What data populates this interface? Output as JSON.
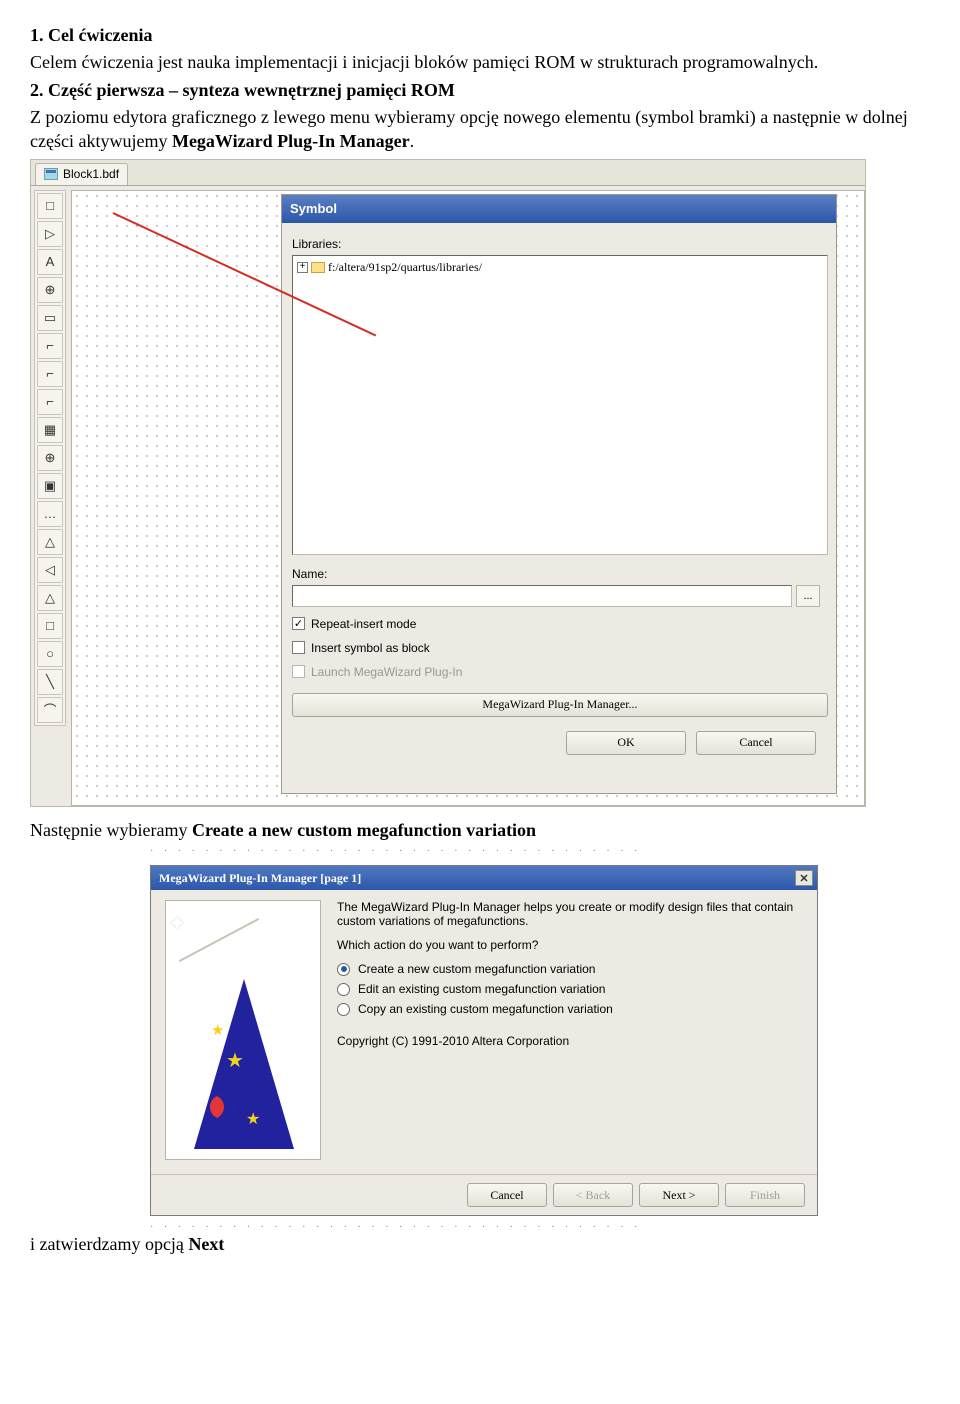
{
  "doc": {
    "h1": "1. Cel ćwiczenia",
    "p1": "Celem ćwiczenia jest nauka implementacji i inicjacji bloków pamięci ROM w strukturach programowalnych.",
    "h2": "2. Część pierwsza – synteza wewnętrznej pamięci ROM",
    "p2a": "Z poziomu edytora graficznego z lewego menu wybieramy opcję nowego elementu (symbol bramki) a następnie w dolnej części aktywujemy ",
    "p2b": "MegaWizard Plug-In Manager",
    "p2c": ".",
    "p3a": "Następnie wybieramy ",
    "p3b": "Create a new custom megafunction variation",
    "p4a": "i zatwierdzamy opcją ",
    "p4b": "Next"
  },
  "shot1": {
    "tab_label": "Block1.bdf",
    "tool_icons": [
      "□",
      "▷",
      "A",
      "⊕",
      "▭",
      "⌐",
      "⌐",
      "⌐",
      "▦",
      "⊕",
      "▣",
      "…",
      "△",
      "◁",
      "△",
      "□",
      "○",
      "╲",
      "⌒"
    ],
    "dialog_title": "Symbol",
    "libraries_label": "Libraries:",
    "tree_item": "f:/altera/91sp2/quartus/libraries/",
    "name_label": "Name:",
    "name_value": "",
    "browse_btn": "...",
    "chk_repeat": "Repeat-insert mode",
    "chk_block": "Insert symbol as block",
    "chk_launch": "Launch MegaWizard Plug-In",
    "mega_btn": "MegaWizard Plug-In Manager...",
    "ok_btn": "OK",
    "cancel_btn": "Cancel"
  },
  "shot2": {
    "title": "MegaWizard Plug-In Manager [page 1]",
    "intro": "The MegaWizard Plug-In Manager helps you create or modify design files that contain custom variations of megafunctions.",
    "question": "Which action do you want to perform?",
    "opt_create": "Create a new custom megafunction variation",
    "opt_edit": "Edit an existing custom megafunction variation",
    "opt_copy": "Copy an existing custom megafunction variation",
    "copyright": "Copyright (C) 1991-2010 Altera Corporation",
    "btn_cancel": "Cancel",
    "btn_back": "< Back",
    "btn_next": "Next >",
    "btn_finish": "Finish"
  }
}
